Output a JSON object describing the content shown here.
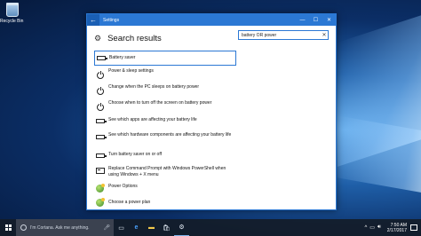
{
  "desktop": {
    "icons": [
      {
        "label": "Recycle Bin",
        "icon": "recycle-bin-icon"
      }
    ]
  },
  "window": {
    "title": "Settings",
    "back_icon": "←",
    "controls": {
      "minimize": "—",
      "maximize": "☐",
      "close": "✕"
    },
    "header": {
      "title": "Search results",
      "icon": "gear-icon"
    },
    "search": {
      "value": "battery OR power",
      "clear_icon": "✕"
    },
    "results": [
      {
        "label": "Battery saver",
        "icon": "battery-icon",
        "selected": true
      },
      {
        "label": "Power & sleep settings",
        "icon": "power-icon"
      },
      {
        "label": "Change when the PC sleeps on battery power",
        "icon": "power-icon"
      },
      {
        "label": "Choose when to turn off the screen on battery power",
        "icon": "power-icon"
      },
      {
        "label": "See which apps are affecting your battery life",
        "icon": "battery-icon"
      },
      {
        "label": "See which hardware components are affecting your battery life",
        "icon": "battery-icon"
      },
      {
        "label": "Turn battery saver on or off",
        "icon": "battery-icon"
      },
      {
        "label": "Replace Command Prompt with Windows PowerShell when using Windows + X menu",
        "icon": "command-prompt-icon"
      },
      {
        "label": "Power Options",
        "icon": "power-options-icon"
      },
      {
        "label": "Choose a power plan",
        "icon": "power-options-icon"
      }
    ]
  },
  "taskbar": {
    "cortana_placeholder": "I'm Cortana. Ask me anything.",
    "clock": {
      "time": "7:50 AM",
      "date": "2/17/2017"
    }
  },
  "colors": {
    "accent": "#2b78d4",
    "taskbar": "#141c28"
  }
}
